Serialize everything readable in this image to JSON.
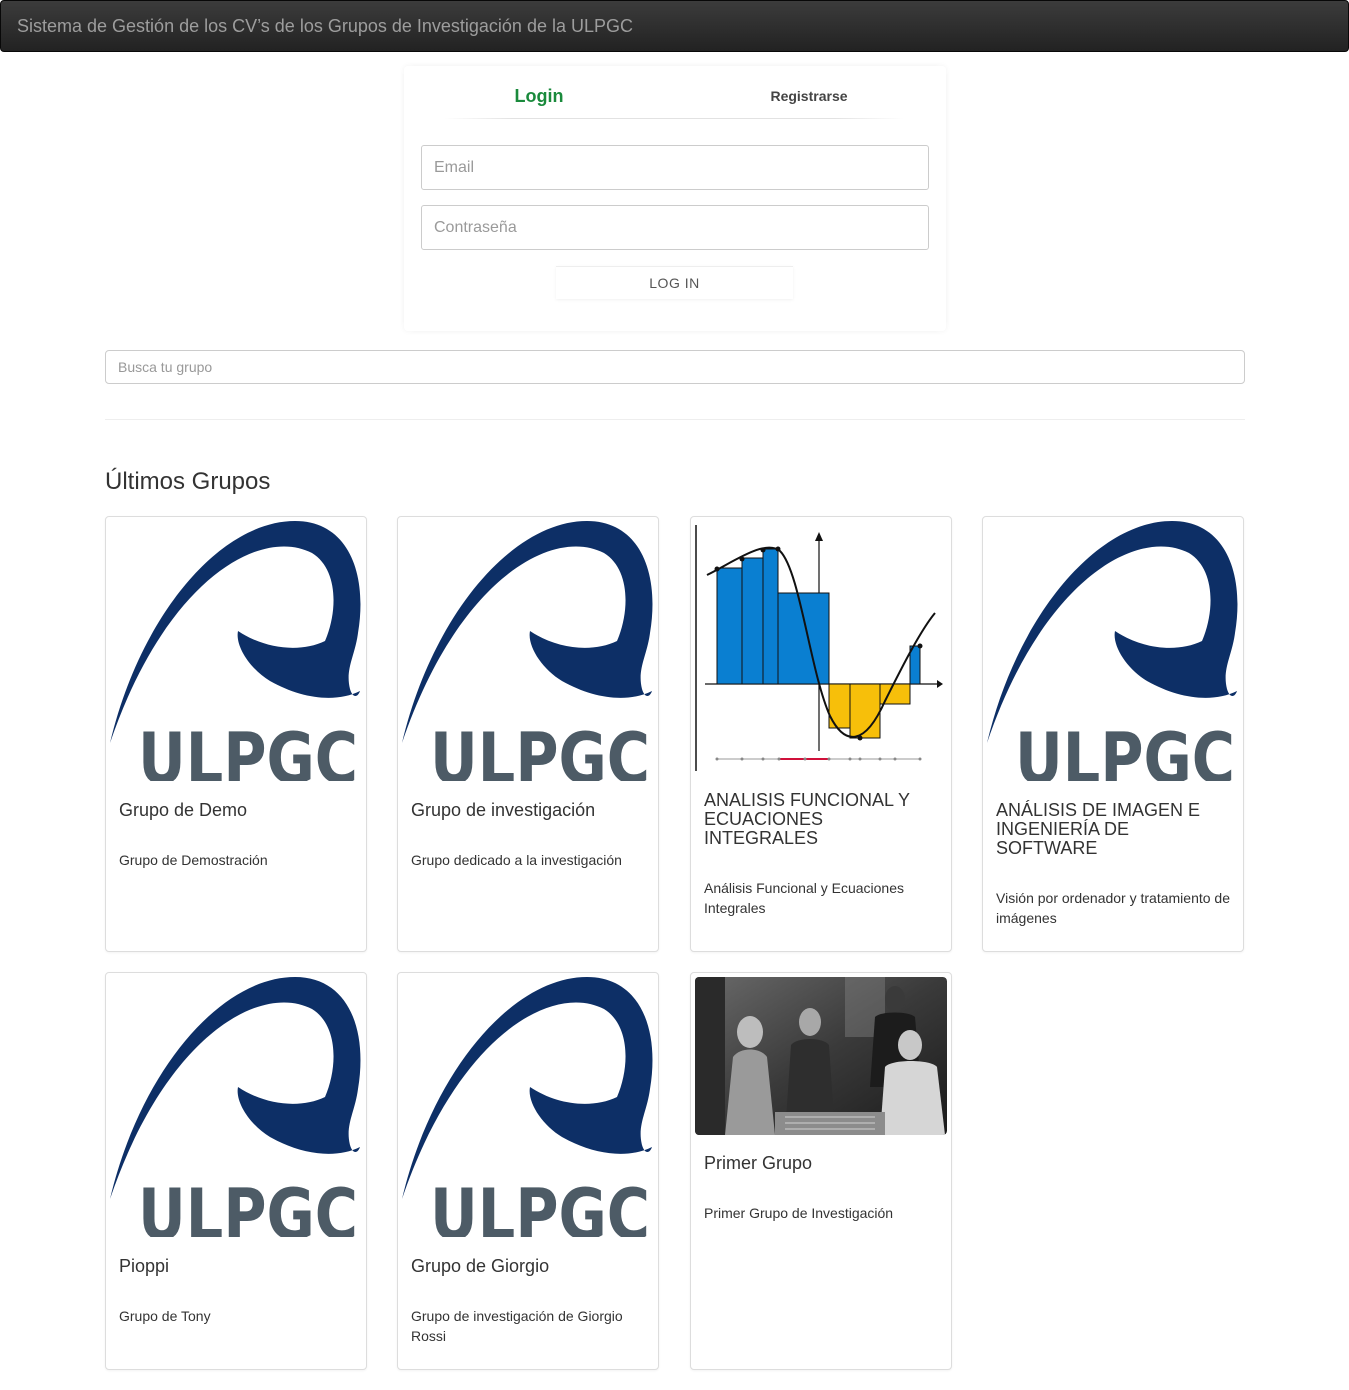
{
  "app": {
    "title": "Sistema de Gestión de los CV’s de los Grupos de Investigación de la ULPGC"
  },
  "login": {
    "tab_login": "Login",
    "tab_register": "Registrarse",
    "email_placeholder": "Email",
    "password_placeholder": "Contraseña",
    "submit_label": "LOG IN"
  },
  "search": {
    "placeholder": "Busca tu grupo"
  },
  "section_title": "Últimos Grupos",
  "logo_text": "ULPGC",
  "colors": {
    "accent_green": "#1a8a3c",
    "logo_blue": "#0d2f66",
    "logo_gray": "#4d5b66",
    "chart_blue": "#0a7fd1",
    "chart_yellow": "#f7bf0a"
  },
  "groups": [
    {
      "title": "Grupo de Demo",
      "description": "Grupo de Demostración",
      "image": "ulpgc-logo"
    },
    {
      "title": "Grupo de investigación",
      "description": "Grupo dedicado a la investigación",
      "image": "ulpgc-logo"
    },
    {
      "title": "ANALISIS FUNCIONAL Y ECUACIONES INTEGRALES",
      "description": "Análisis Funcional y Ecuaciones Integrales",
      "image": "integral-chart"
    },
    {
      "title": "ANÁLISIS DE IMAGEN E INGENIERÍA DE SOFTWARE",
      "description": "Visión por ordenador y tratamiento de imágenes",
      "image": "ulpgc-logo"
    },
    {
      "title": "Pioppi",
      "description": "Grupo de Tony",
      "image": "ulpgc-logo"
    },
    {
      "title": "Grupo de Giorgio",
      "description": "Grupo de investigación de Giorgio Rossi",
      "image": "ulpgc-logo"
    },
    {
      "title": "Primer Grupo",
      "description": "Primer Grupo de Investigación",
      "image": "group-photo"
    }
  ]
}
